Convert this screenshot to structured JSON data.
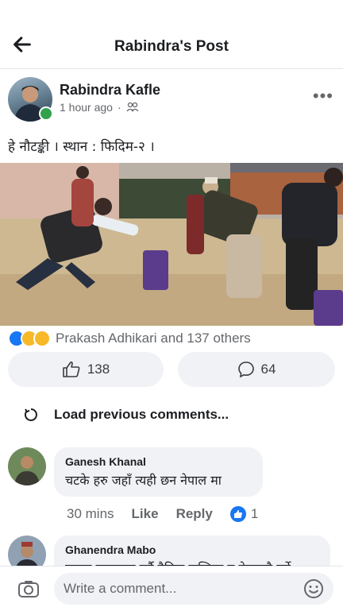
{
  "header": {
    "title": "Rabindra's Post",
    "back_icon": "arrow-left-icon"
  },
  "post": {
    "author": "Rabindra Kafle",
    "time": "1 hour ago",
    "separator": "·",
    "privacy_icon": "friends-icon",
    "more_icon": "more-dots-icon",
    "more_label": "•••",
    "text": "हे नौटङ्की । स्थान : फिदिम-२ ।",
    "photo_icon": "post-photo"
  },
  "reactions": {
    "icons": [
      "like-reaction-icon",
      "haha-reaction-icon",
      "sad-reaction-icon"
    ],
    "summary": "Prakash Adhikari and 137 others"
  },
  "actions": {
    "like_count": "138",
    "comment_count": "64"
  },
  "comments": {
    "load_previous": "Load previous comments...",
    "items": [
      {
        "name": "Ganesh Khanal",
        "text": "चटके हरु जहाँ त्यही छन नेपाल मा",
        "time": "30 mins",
        "like_label": "Like",
        "reply_label": "Reply",
        "like_count": "1"
      },
      {
        "name": "Ghanendra Mabo",
        "text": "त्यस्ता उल्लाङ्गन गर्नै दैनिक जन्तिमा त नेपालमै गर्ने"
      }
    ]
  },
  "composer": {
    "placeholder": "Write a comment...",
    "camera_icon": "camera-icon",
    "emoji_icon": "emoji-icon"
  },
  "colors": {
    "accent": "#1877f2",
    "online": "#31a24c",
    "muted": "#65676b",
    "bubble": "#f0f2f5"
  }
}
